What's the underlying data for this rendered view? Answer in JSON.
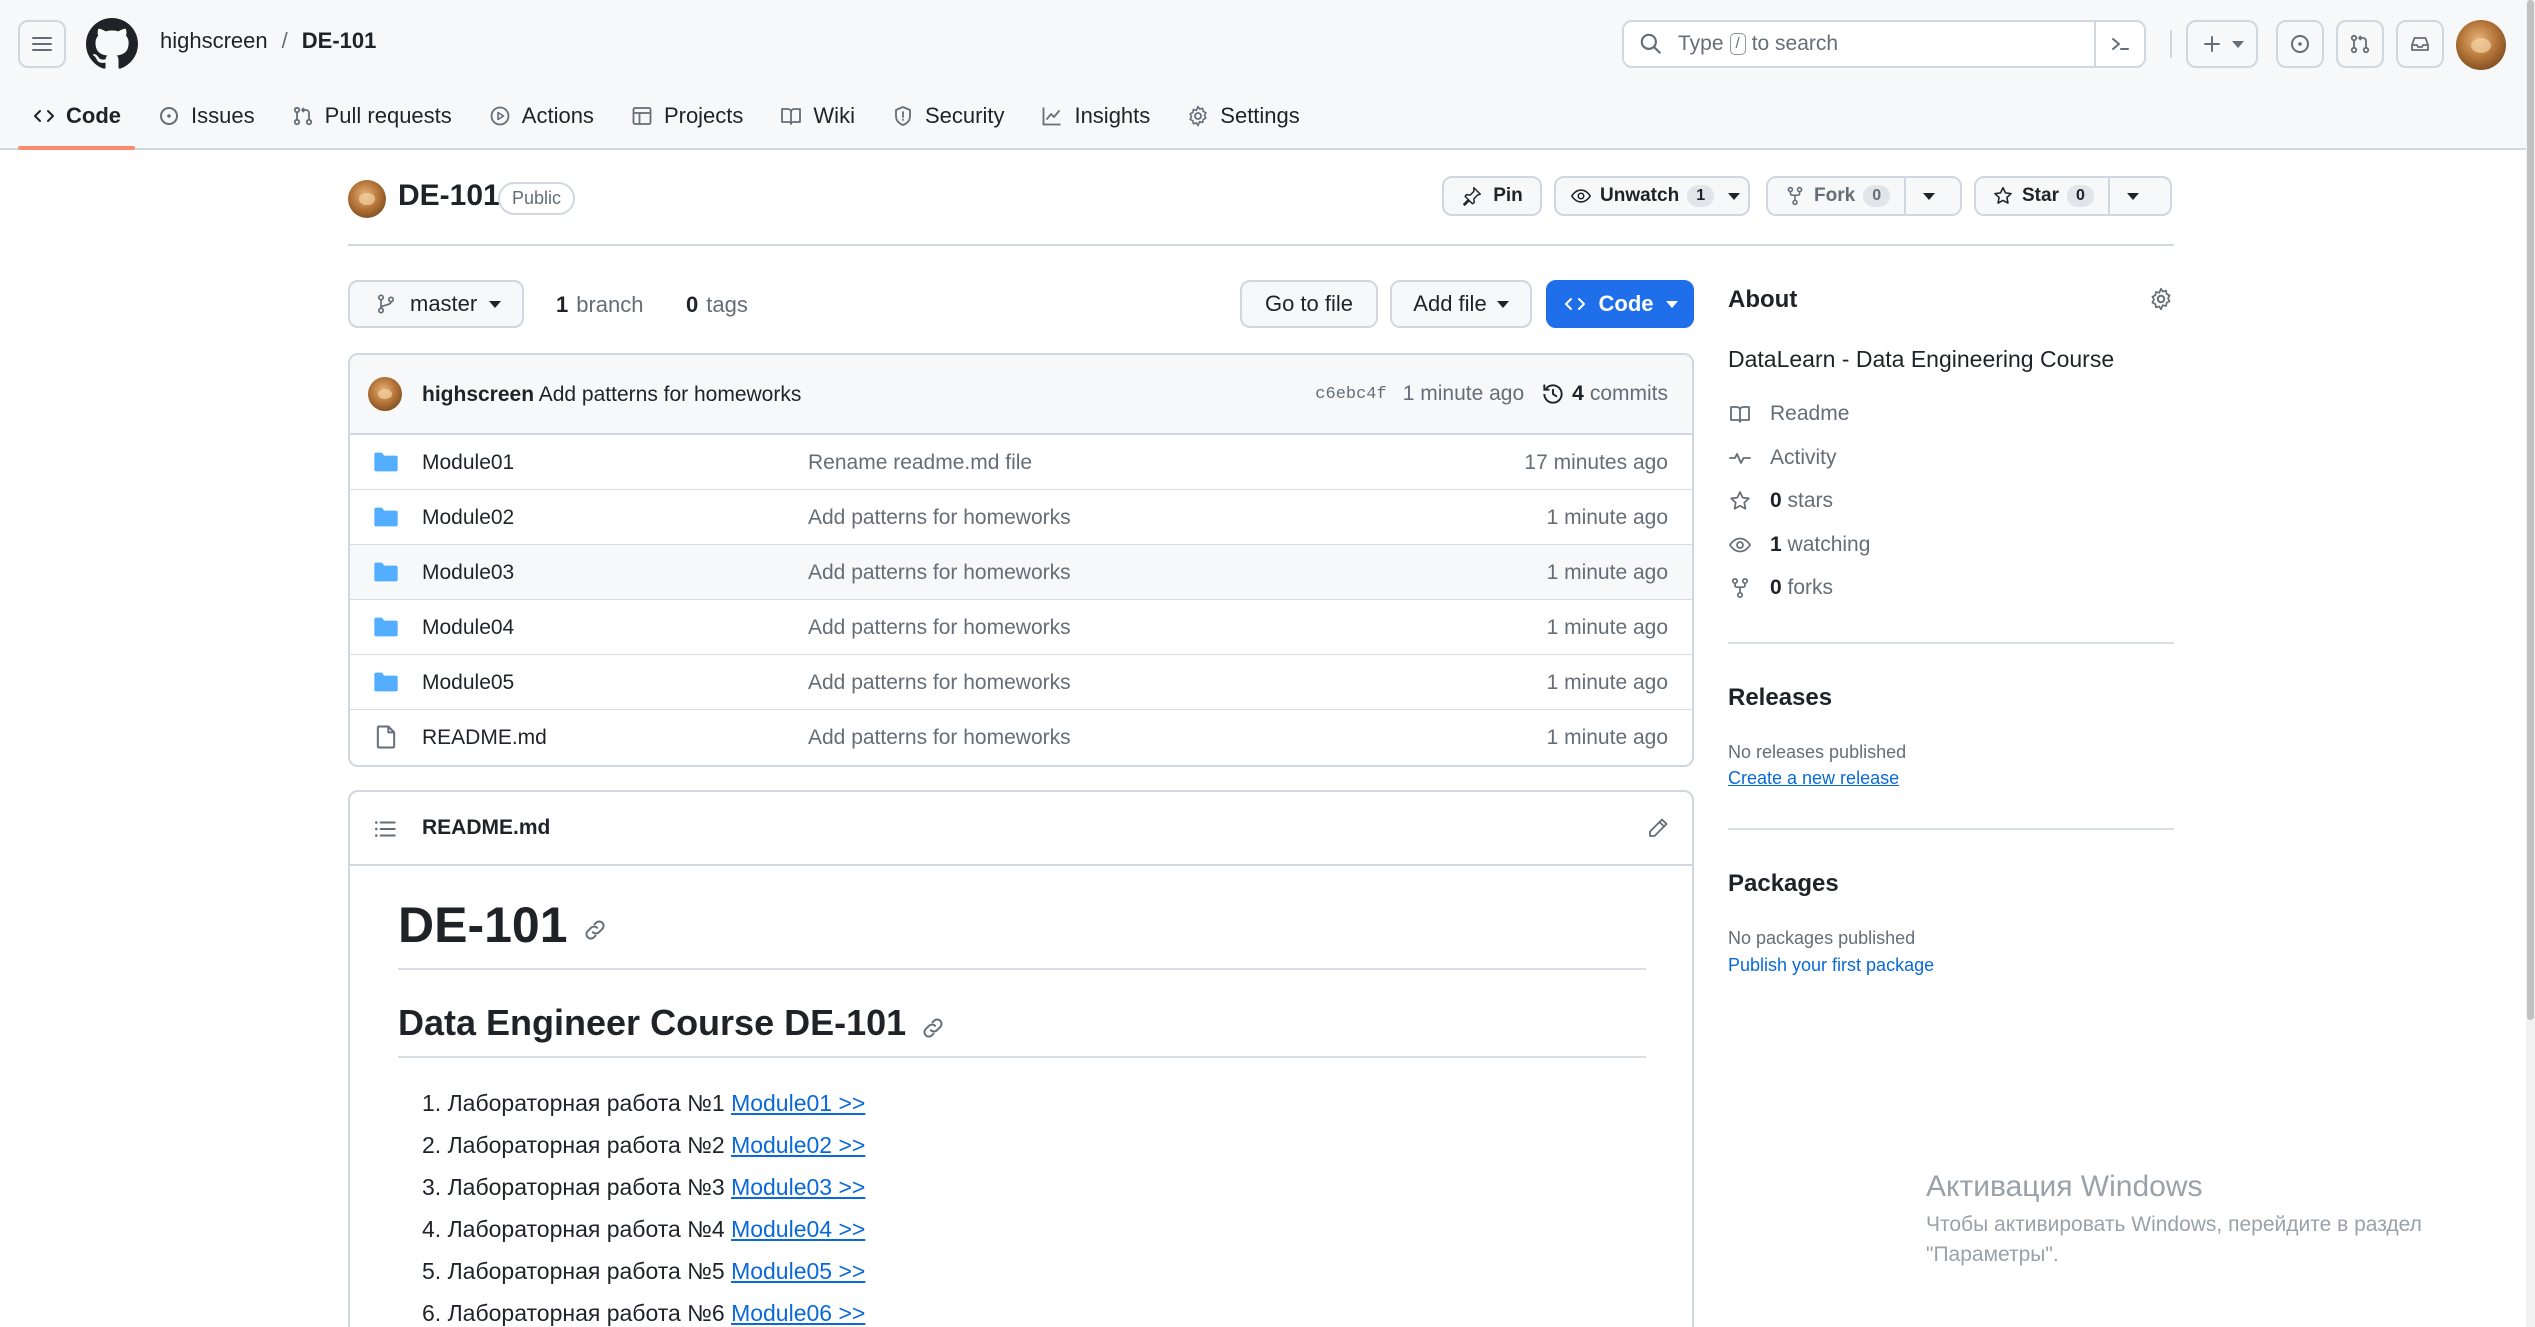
{
  "header": {
    "owner": "highscreen",
    "separator": "/",
    "repo": "DE-101",
    "search_placeholder_pre": "Type",
    "search_key": "/",
    "search_placeholder_post": "to search",
    "icons": [
      "menu-icon",
      "github-logo-icon",
      "search-icon",
      "terminal-icon",
      "plus-icon",
      "issue-icon",
      "pull-request-icon",
      "inbox-icon"
    ]
  },
  "nav": {
    "tabs": [
      {
        "label": "Code",
        "icon": "code-icon",
        "active": true
      },
      {
        "label": "Issues",
        "icon": "issue-icon"
      },
      {
        "label": "Pull requests",
        "icon": "pull-request-icon"
      },
      {
        "label": "Actions",
        "icon": "play-icon"
      },
      {
        "label": "Projects",
        "icon": "table-icon"
      },
      {
        "label": "Wiki",
        "icon": "book-icon"
      },
      {
        "label": "Security",
        "icon": "shield-icon"
      },
      {
        "label": "Insights",
        "icon": "graph-icon"
      },
      {
        "label": "Settings",
        "icon": "gear-icon"
      }
    ]
  },
  "repo_head": {
    "name": "DE-101",
    "visibility": "Public",
    "pin": "Pin",
    "unwatch": "Unwatch",
    "watch_count": "1",
    "fork": "Fork",
    "fork_count": "0",
    "star": "Star",
    "star_count": "0"
  },
  "toolbar": {
    "branch": "master",
    "branch_count": "1",
    "branch_label": "branch",
    "tag_count": "0",
    "tag_label": "tags",
    "go_to_file": "Go to file",
    "add_file": "Add file",
    "code": "Code"
  },
  "commit": {
    "author": "highscreen",
    "message": "Add patterns for homeworks",
    "sha": "c6ebc4f",
    "time": "1 minute ago",
    "count": "4",
    "count_label": "commits"
  },
  "files": [
    {
      "name": "Module01",
      "type": "folder",
      "message": "Rename readme.md file",
      "time": "17 minutes ago"
    },
    {
      "name": "Module02",
      "type": "folder",
      "message": "Add patterns for homeworks",
      "time": "1 minute ago"
    },
    {
      "name": "Module03",
      "type": "folder",
      "message": "Add patterns for homeworks",
      "time": "1 minute ago"
    },
    {
      "name": "Module04",
      "type": "folder",
      "message": "Add patterns for homeworks",
      "time": "1 minute ago"
    },
    {
      "name": "Module05",
      "type": "folder",
      "message": "Add patterns for homeworks",
      "time": "1 minute ago"
    },
    {
      "name": "README.md",
      "type": "file",
      "message": "Add patterns for homeworks",
      "time": "1 minute ago"
    }
  ],
  "readme": {
    "filename": "README.md",
    "h1": "DE-101",
    "h2": "Data Engineer Course DE-101",
    "items": [
      {
        "num": "1.",
        "text": "Лабораторная работа №1",
        "link": "Module01 >>"
      },
      {
        "num": "2.",
        "text": "Лабораторная работа №2",
        "link": "Module02 >>"
      },
      {
        "num": "3.",
        "text": "Лабораторная работа №3",
        "link": "Module03 >>"
      },
      {
        "num": "4.",
        "text": "Лабораторная работа №4",
        "link": "Module04 >>"
      },
      {
        "num": "5.",
        "text": "Лабораторная работа №5",
        "link": "Module05 >>"
      },
      {
        "num": "6.",
        "text": "Лабораторная работа №6",
        "link": "Module06 >>"
      }
    ]
  },
  "about": {
    "title": "About",
    "description": "DataLearn - Data Engineering Course",
    "readme": "Readme",
    "activity": "Activity",
    "stars_count": "0",
    "stars_label": "stars",
    "watching_count": "1",
    "watching_label": "watching",
    "forks_count": "0",
    "forks_label": "forks"
  },
  "releases": {
    "title": "Releases",
    "empty": "No releases published",
    "link": "Create a new release"
  },
  "packages": {
    "title": "Packages",
    "empty": "No packages published",
    "link": "Publish your first package"
  },
  "watermark": {
    "title": "Активация Windows",
    "line1": "Чтобы активировать Windows, перейдите в раздел",
    "line2": "\"Параметры\"."
  },
  "colors": {
    "accent": "#1f6feb",
    "link": "#0969da",
    "folder": "#54aeff",
    "tab_underline": "#fd8c73"
  }
}
